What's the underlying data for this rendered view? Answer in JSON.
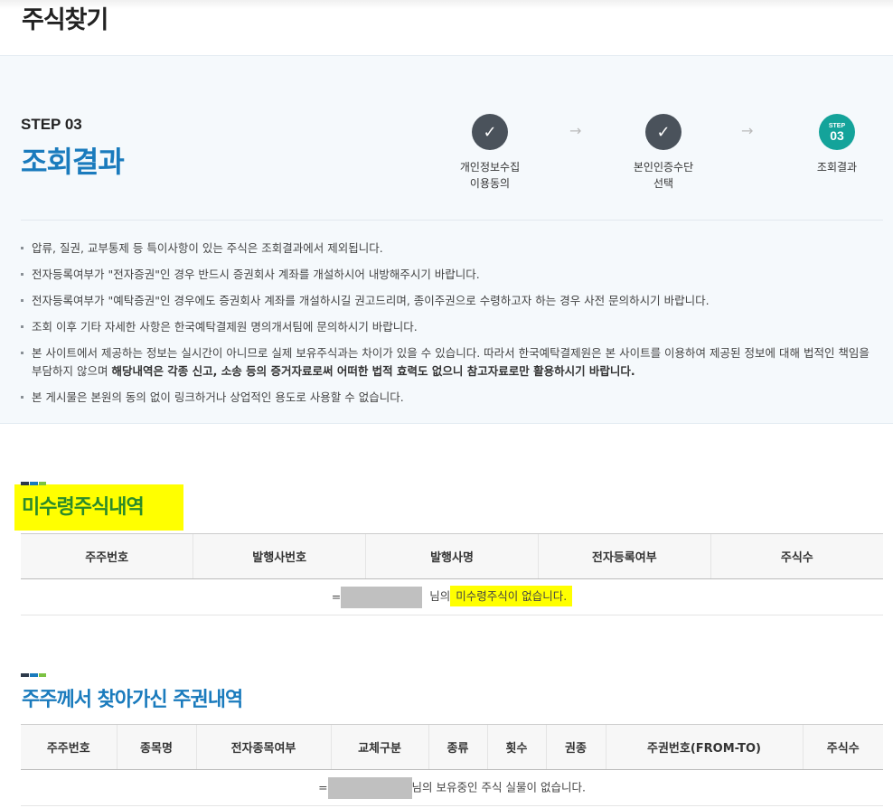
{
  "page": {
    "title": "주식찾기"
  },
  "step": {
    "label": "STEP 03",
    "name": "조회결과",
    "items": [
      {
        "line1": "개인정보수집",
        "line2": "이용동의",
        "icon": "check-icon"
      },
      {
        "line1": "본인인증수단",
        "line2": "선택",
        "icon": "check-icon"
      },
      {
        "step_small": "STEP",
        "step_num": "03",
        "line1": "조회결과"
      }
    ],
    "arrow": "→"
  },
  "notes": [
    "압류, 질권, 교부통제 등 특이사항이 있는 주식은 조회결과에서 제외됩니다.",
    "전자등록여부가 \"전자증권\"인 경우 반드시 증권회사 계좌를 개설하시어 내방해주시기 바랍니다.",
    "전자등록여부가 \"예탁증권\"인 경우에도 증권회사 계좌를 개설하시길 권고드리며, 종이주권으로 수령하고자 하는 경우 사전 문의하시기 바랍니다.",
    "조회 이후 기타 자세한 사항은 한국예탁결제원 명의개서팀에 문의하시기 바랍니다."
  ],
  "note5": {
    "text": "본 사이트에서 제공하는 정보는 실시간이 아니므로 실제 보유주식과는 차이가 있을 수 있습니다. 따라서 한국예탁결제원은 본 사이트를 이용하여 제공된 정보에 대해 법적인 책임을 부담하지 않으며 ",
    "bold": "해당내역은 각종 신고, 소송 등의 증거자료로써 어떠한 법적 효력도 없으니 참고자료로만 활용하시기 바랍니다."
  },
  "note6": "본 게시물은 본원의 동의 없이 링크하거나 상업적인 용도로 사용할 수 없습니다.",
  "section1": {
    "title": "미수령주식내역",
    "columns": [
      "주주번호",
      "발행사번호",
      "발행사명",
      "전자등록여부",
      "주식수"
    ],
    "empty_prefix": "=",
    "empty_mid": "님의",
    "empty_hl": "미수령주식이 없습니다."
  },
  "section2": {
    "title": "주주께서 찾아가신 주권내역",
    "columns": [
      "주주번호",
      "종목명",
      "전자종목여부",
      "교체구분",
      "종류",
      "횟수",
      "권종",
      "주권번호(FROM-TO)",
      "주식수"
    ],
    "empty_prefix": "=",
    "empty_msg": "님의 보유중인 주식 실물이 없습니다."
  },
  "colors": {
    "accent": "#1a7bbd",
    "teal": "#14a39a",
    "highlight": "#ffff00",
    "bar1": "#2d3a4a",
    "bar2": "#1a7bbd",
    "bar3": "#7cc242"
  }
}
